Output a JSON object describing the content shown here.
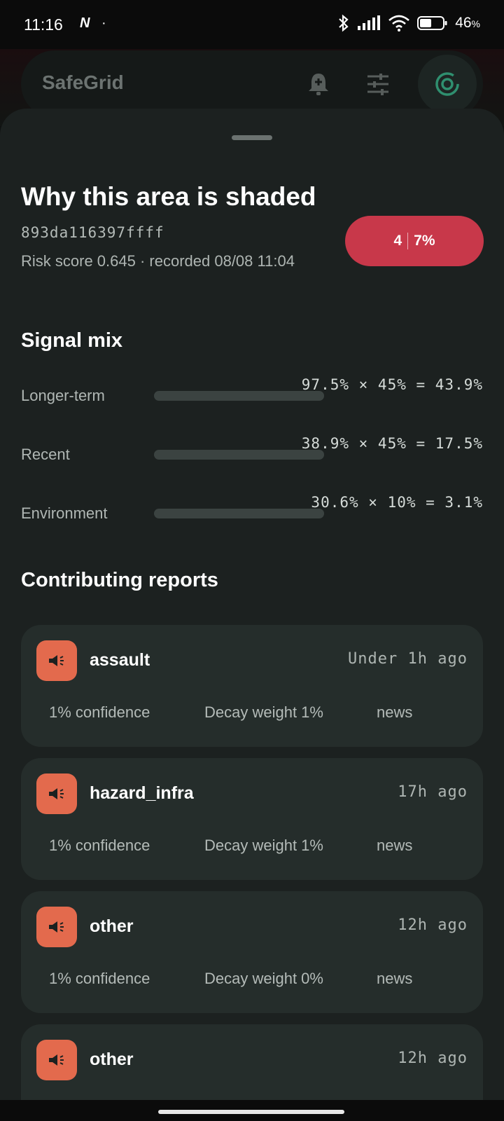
{
  "status_bar": {
    "time": "11:16",
    "notif_icon_letter": "N",
    "dot": "·",
    "battery_percent": "46",
    "battery_unit": "%",
    "icons": [
      "bluetooth-icon",
      "signal-icon",
      "wifi-icon",
      "battery-icon"
    ]
  },
  "app_bar": {
    "title": "SafeGrid",
    "icons": [
      "add-alert-icon",
      "tune-icon",
      "radar-icon"
    ]
  },
  "sheet": {
    "title": "Why this area is shaded",
    "cell_id": "893da116397ffff",
    "meta": "Risk score 0.645 · recorded 08/08 11:04",
    "risk_badge": {
      "left": "4",
      "right": "7%",
      "color": "#c8384a"
    },
    "signal_mix_heading": "Signal mix",
    "signals": [
      {
        "label": "Longer-term",
        "formula": "97.5% × 45% = 43.9%",
        "fill": 0
      },
      {
        "label": "Recent",
        "formula": "38.9% × 45% = 17.5%",
        "fill": 0
      },
      {
        "label": "Environment",
        "formula": "30.6% × 10% = 3.1%",
        "fill": 0
      }
    ],
    "reports_heading": "Contributing reports",
    "reports": [
      {
        "type": "assault",
        "time": "Under 1h ago",
        "confidence": "1% confidence",
        "decay": "Decay weight 1%",
        "source": "news",
        "icon": "megaphone-icon"
      },
      {
        "type": "hazard_infra",
        "time": "17h ago",
        "confidence": "1% confidence",
        "decay": "Decay weight 1%",
        "source": "news",
        "icon": "megaphone-icon"
      },
      {
        "type": "other",
        "time": "12h ago",
        "confidence": "1% confidence",
        "decay": "Decay weight 0%",
        "source": "news",
        "icon": "megaphone-icon"
      },
      {
        "type": "other",
        "time": "12h ago",
        "confidence": "",
        "decay": "",
        "source": "",
        "icon": "megaphone-icon"
      }
    ]
  },
  "colors": {
    "accent": "#e36a4d",
    "risk": "#c8384a",
    "radar": "#2f8f6f"
  }
}
